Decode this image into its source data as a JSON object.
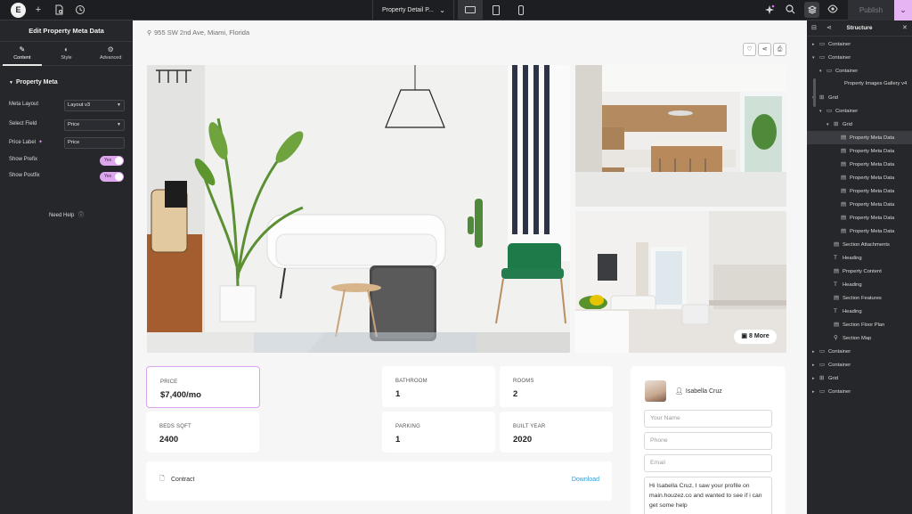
{
  "topbar": {
    "logo": "E",
    "add_icon": "+",
    "document_title": "Property Detail P...",
    "publish_label": "Publish"
  },
  "left_panel": {
    "title": "Edit Property Meta Data",
    "tabs": [
      {
        "label": "Content",
        "icon": "pencil-icon"
      },
      {
        "label": "Style",
        "icon": "half-circle-icon"
      },
      {
        "label": "Advanced",
        "icon": "gear-icon"
      }
    ],
    "section_title": "Property Meta",
    "controls": {
      "meta_layout": {
        "label": "Meta Layout",
        "value": "Layout v3"
      },
      "select_field": {
        "label": "Select Field",
        "value": "Price"
      },
      "price_label": {
        "label": "Price Label",
        "value": "Price"
      },
      "show_prefix": {
        "label": "Show Prefix",
        "value": "Yes"
      },
      "show_postfix": {
        "label": "Show Postfix",
        "value": "Yes"
      }
    },
    "need_help": "Need Help"
  },
  "canvas": {
    "address": "955 SW 2nd Ave, Miami, Florida",
    "more_photos": "8 More",
    "meta_cards": [
      {
        "label": "PRICE",
        "value": "$7,400/mo"
      },
      {
        "label": "BATHROOM",
        "value": "1"
      },
      {
        "label": "ROOMS",
        "value": "2"
      },
      {
        "label": "BEDS SQFT",
        "value": "2400"
      },
      {
        "label": "PARKING",
        "value": "1"
      },
      {
        "label": "BUILT YEAR",
        "value": "2020"
      }
    ],
    "contract": {
      "label": "Contract",
      "download": "Download"
    },
    "contact": {
      "agent_name": "Isabella Cruz",
      "name_placeholder": "Your Name",
      "phone_placeholder": "Phone",
      "email_placeholder": "Email",
      "message": "Hi Isabella Cruz, I saw your profile on main.houzez.co and wanted to see if i can get some help"
    }
  },
  "structure": {
    "title": "Structure",
    "items": [
      {
        "label": "Container",
        "icon": "container-icon"
      },
      {
        "label": "Container",
        "icon": "container-icon"
      },
      {
        "label": "Container",
        "icon": "container-icon"
      },
      {
        "label": "Property Images Gallery v4",
        "icon": ""
      },
      {
        "label": "Grid",
        "icon": "grid-icon"
      },
      {
        "label": "Container",
        "icon": "container-icon"
      },
      {
        "label": "Grid",
        "icon": "grid-icon"
      },
      {
        "label": "Property Meta Data",
        "icon": "widget-icon"
      },
      {
        "label": "Property Meta Data",
        "icon": "widget-icon"
      },
      {
        "label": "Property Meta Data",
        "icon": "widget-icon"
      },
      {
        "label": "Property Meta Data",
        "icon": "widget-icon"
      },
      {
        "label": "Property Meta Data",
        "icon": "widget-icon"
      },
      {
        "label": "Property Meta Data",
        "icon": "widget-icon"
      },
      {
        "label": "Property Meta Data",
        "icon": "widget-icon"
      },
      {
        "label": "Property Meta Data",
        "icon": "widget-icon"
      },
      {
        "label": "Section Attachments",
        "icon": "widget-icon"
      },
      {
        "label": "Heading",
        "icon": "heading-icon"
      },
      {
        "label": "Property Content",
        "icon": "widget-icon"
      },
      {
        "label": "Heading",
        "icon": "heading-icon"
      },
      {
        "label": "Section Features",
        "icon": "widget-icon"
      },
      {
        "label": "Heading",
        "icon": "heading-icon"
      },
      {
        "label": "Section Floor Plan",
        "icon": "widget-icon"
      },
      {
        "label": "Section Map",
        "icon": "map-pin-icon"
      },
      {
        "label": "Container",
        "icon": "container-icon"
      },
      {
        "label": "Container",
        "icon": "container-icon"
      },
      {
        "label": "Grid",
        "icon": "grid-icon"
      },
      {
        "label": "Container",
        "icon": "container-icon"
      }
    ]
  },
  "colors": {
    "accent": "#dca7ec",
    "panel_bg": "#26272b",
    "link": "#2d9bd6"
  }
}
